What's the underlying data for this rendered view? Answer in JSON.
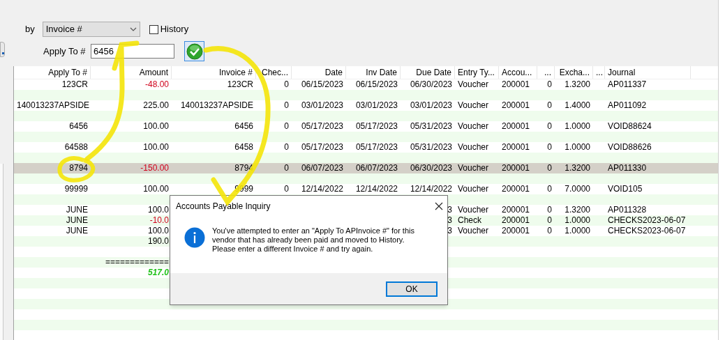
{
  "filter": {
    "by_label": "by",
    "by_value": "Invoice #",
    "history": {
      "label": "History",
      "checked": false
    },
    "apply_to_label": "Apply To #",
    "apply_to_value": "6456"
  },
  "table": {
    "columns": [
      {
        "label": "Apply To #"
      },
      {
        "label": "Amount"
      },
      {
        "label": "Invoice #"
      },
      {
        "label": "Chec..."
      },
      {
        "label": "Date"
      },
      {
        "label": "Inv Date"
      },
      {
        "label": "Due Date"
      },
      {
        "label": "Entry Ty..."
      },
      {
        "label": "Accou..."
      },
      {
        "label": "..."
      },
      {
        "label": "Excha..."
      },
      {
        "label": "..."
      },
      {
        "label": "Journal"
      }
    ],
    "rows": [
      {
        "kind": "invoice",
        "selected": false,
        "negative": true,
        "apply_to": "123CR",
        "amount": "-48.00",
        "invoice": "123CR",
        "check": "0",
        "date": "06/15/2023",
        "inv_date": "06/15/2023",
        "due_date": "06/30/2023",
        "entry_type": "Voucher",
        "account": "200001",
        "column_10": "0",
        "exchange": "1.3200",
        "journal": "AP011337"
      },
      {
        "kind": "invoice",
        "selected": false,
        "negative": false,
        "apply_to": "140013237APSIDE",
        "amount": "225.00",
        "invoice": "140013237APSIDE",
        "check": "0",
        "date": "03/01/2023",
        "inv_date": "03/01/2023",
        "due_date": "03/01/2023",
        "entry_type": "Voucher",
        "account": "200001",
        "column_10": "0",
        "exchange": "1.4000",
        "journal": "AP011092"
      },
      {
        "kind": "invoice",
        "selected": false,
        "negative": false,
        "apply_to": "6456",
        "amount": "100.00",
        "invoice": "6456",
        "check": "0",
        "date": "05/17/2023",
        "inv_date": "05/17/2023",
        "due_date": "05/31/2023",
        "entry_type": "Voucher",
        "account": "200001",
        "column_10": "0",
        "exchange": "1.0000",
        "journal": "VOID88624"
      },
      {
        "kind": "invoice",
        "selected": false,
        "negative": false,
        "apply_to": "64588",
        "amount": "100.00",
        "invoice": "6458",
        "check": "0",
        "date": "05/17/2023",
        "inv_date": "05/17/2023",
        "due_date": "05/31/2023",
        "entry_type": "Voucher",
        "account": "200001",
        "column_10": "0",
        "exchange": "1.0000",
        "journal": "VOID88626"
      },
      {
        "kind": "invoice",
        "selected": true,
        "negative": true,
        "apply_to": "8794",
        "amount": "-150.00",
        "invoice": "8794",
        "check": "0",
        "date": "06/07/2023",
        "inv_date": "06/07/2023",
        "due_date": "06/30/2023",
        "entry_type": "Voucher",
        "account": "200001",
        "column_10": "0",
        "exchange": "1.3200",
        "journal": "AP011330"
      },
      {
        "kind": "invoice",
        "selected": false,
        "negative": false,
        "apply_to": "99999",
        "amount": "100.00",
        "invoice": "9999",
        "check": "0",
        "date": "12/14/2022",
        "inv_date": "12/14/2022",
        "due_date": "12/14/2022",
        "entry_type": "Voucher",
        "account": "200001",
        "column_10": "0",
        "exchange": "7.0000",
        "journal": "VOID105"
      },
      {
        "kind": "line",
        "selected": false,
        "negative": false,
        "apply_to": "JUNE",
        "amount": "100.0",
        "due_date": "3",
        "entry_type": "Voucher",
        "account": "200001",
        "column_10": "0",
        "exchange": "1.3200",
        "journal": "AP011328"
      },
      {
        "kind": "line",
        "selected": false,
        "negative": true,
        "apply_to": "JUNE",
        "amount": "-10.0",
        "due_date": "3",
        "entry_type": "Check",
        "account": "200001",
        "column_10": "0",
        "exchange": "1.0000",
        "journal": "CHECKS2023-06-07"
      },
      {
        "kind": "line",
        "selected": false,
        "negative": false,
        "apply_to": "JUNE",
        "amount": "100.0",
        "due_date": "3",
        "entry_type": "Voucher",
        "account": "200001",
        "column_10": "0",
        "exchange": "1.0000",
        "journal": "CHECKS2023-06-07"
      },
      {
        "kind": "subtotal",
        "selected": false,
        "negative": false,
        "amount": "190.0"
      },
      {
        "kind": "rule",
        "selected": false,
        "amount": "============="
      },
      {
        "kind": "total",
        "selected": false,
        "amount": "517.0"
      }
    ]
  },
  "dialog": {
    "title": "Accounts Payable Inquiry",
    "message": "You've attempted to enter an \"Apply To APInvoice #\" for this\nvendor that has already been paid and moved to History.\nPlease enter a different Invoice # and try again.",
    "button": "OK"
  }
}
